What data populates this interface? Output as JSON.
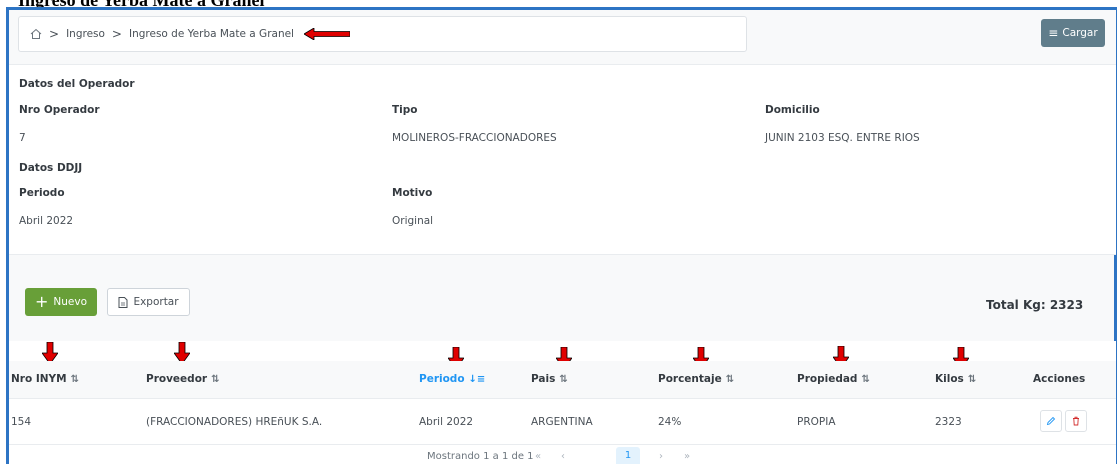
{
  "page_heading": "Ingreso de Yerba Mate a Granel",
  "breadcrumb": {
    "home_icon": "home-icon",
    "items": [
      "Ingreso",
      "Ingreso de Yerba Mate a Granel"
    ],
    "separator": ">"
  },
  "header": {
    "cargar_label": "Cargar",
    "cargar_icon": "menu-icon"
  },
  "operador": {
    "section_title": "Datos del Operador",
    "nro_label": "Nro Operador",
    "nro_value": "7",
    "tipo_label": "Tipo",
    "tipo_value": "MOLINEROS-FRACCIONADORES",
    "domicilio_label": "Domicilio",
    "domicilio_value": "JUNIN 2103 ESQ. ENTRE RIOS"
  },
  "ddjj": {
    "section_title": "Datos DDJJ",
    "periodo_label": "Periodo",
    "periodo_value": "Abril 2022",
    "motivo_label": "Motivo",
    "motivo_value": "Original"
  },
  "toolbar": {
    "nuevo_label": "Nuevo",
    "exportar_label": "Exportar",
    "total_label": "Total Kg: 2323"
  },
  "table": {
    "columns": [
      "Nro INYM",
      "Proveedor",
      "Periodo",
      "Pais",
      "Porcentaje",
      "Propiedad",
      "Kilos",
      "Acciones"
    ],
    "rows": [
      {
        "nro_inym": "154",
        "proveedor": "(FRACCIONADORES) HREñUK S.A.",
        "periodo": "Abril 2022",
        "pais": "ARGENTINA",
        "porcentaje": "24%",
        "propiedad": "PROPIA",
        "kilos": "2323"
      }
    ]
  },
  "paginator": {
    "text": "Mostrando 1 a 1 de 1",
    "current_page": "1"
  },
  "colors": {
    "frame_border": "#2d74c4",
    "cargar_button": "#607d8b",
    "nuevo_button": "#689f38",
    "active_sort": "#2196f3",
    "annotation_arrow": "#e00000"
  }
}
